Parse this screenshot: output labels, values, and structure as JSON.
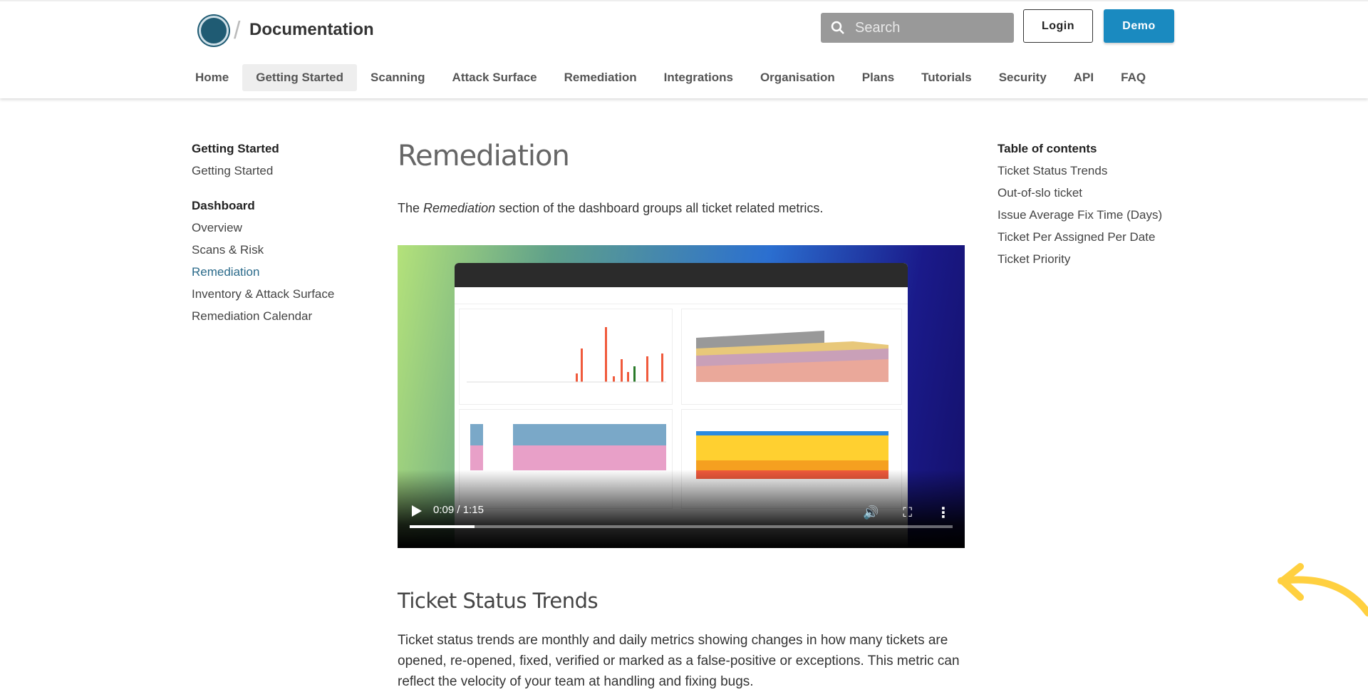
{
  "header": {
    "title": "Documentation",
    "search_placeholder": "Search",
    "login": "Login",
    "demo": "Demo",
    "accent": "#1a8ac0"
  },
  "nav": [
    "Home",
    "Getting Started",
    "Scanning",
    "Attack Surface",
    "Remediation",
    "Integrations",
    "Organisation",
    "Plans",
    "Tutorials",
    "Security",
    "API",
    "FAQ"
  ],
  "nav_active": "Getting Started",
  "sidebar": {
    "groups": [
      {
        "heading": "Getting Started",
        "items": [
          "Getting Started"
        ]
      },
      {
        "heading": "Dashboard",
        "items": [
          "Overview",
          "Scans & Risk",
          "Remediation",
          "Inventory & Attack Surface",
          "Remediation Calendar"
        ]
      }
    ],
    "active": "Remediation"
  },
  "main": {
    "title": "Remediation",
    "intro_pre": "The ",
    "intro_em": "Remediation",
    "intro_post": " section of the dashboard groups all ticket related metrics.",
    "video": {
      "current": "0:09",
      "duration": "1:15",
      "time_sep": " / ",
      "progress": 0.12
    },
    "section_title": "Ticket Status Trends",
    "section_text": "Ticket status trends are monthly and daily metrics showing changes in how many tickets are opened, re-opened, fixed, verified or marked as a false-positive or exceptions. This metric can reflect the velocity of your team at handling and fixing bugs."
  },
  "toc": {
    "heading": "Table of contents",
    "items": [
      "Ticket Status Trends",
      "Out-of-slo ticket",
      "Issue Average Fix Time (Days)",
      "Ticket Per Assigned Per Date",
      "Ticket Priority"
    ]
  }
}
